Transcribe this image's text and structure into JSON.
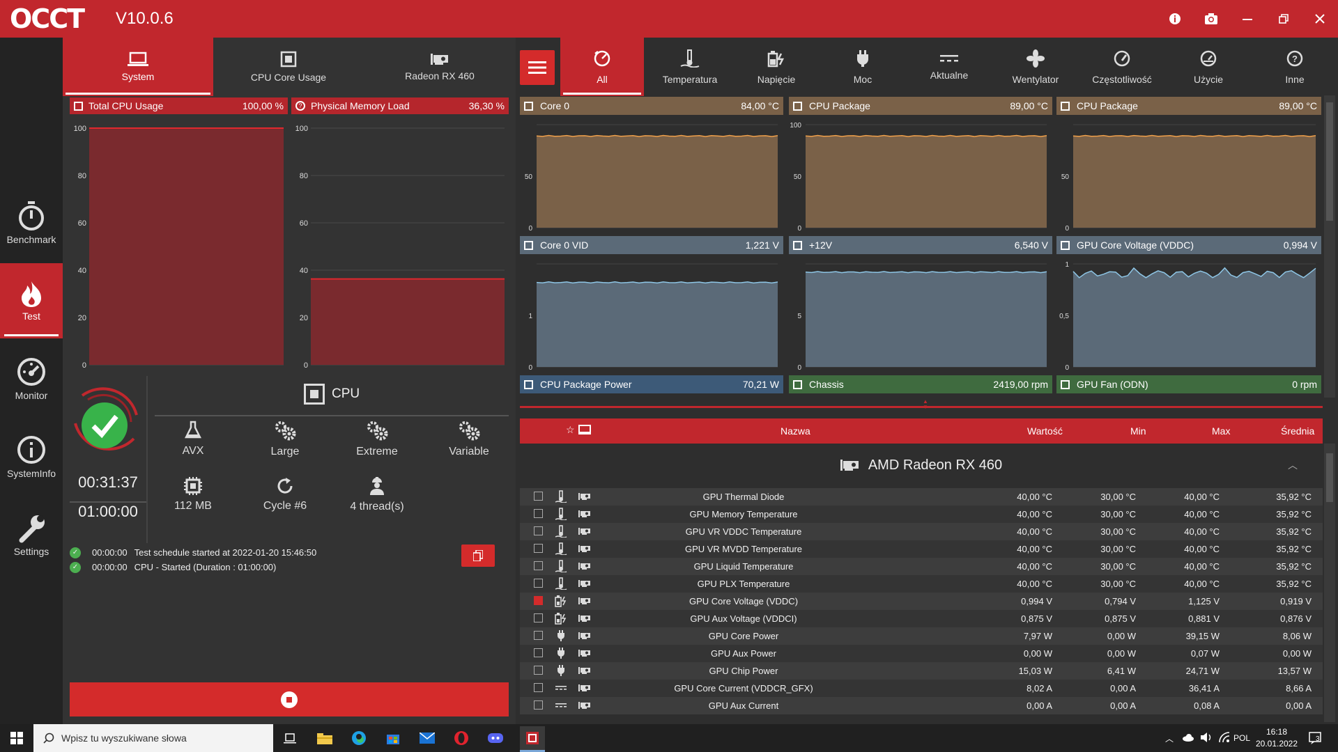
{
  "app": {
    "logo": "OCCT",
    "version": "V10.0.6"
  },
  "nav": [
    {
      "label": "Benchmark"
    },
    {
      "label": "Test"
    },
    {
      "label": "Monitor"
    },
    {
      "label": "SystemInfo"
    },
    {
      "label": "Settings"
    }
  ],
  "left_tabs": [
    "System",
    "CPU Core Usage",
    "Radeon RX 460"
  ],
  "left_charts": [
    {
      "title": "Total CPU Usage",
      "value": "100,00 %",
      "ticks": [
        "100",
        "80",
        "60",
        "40",
        "20",
        "0"
      ]
    },
    {
      "title": "Physical Memory Load",
      "value": "36,30 %",
      "ticks": [
        "100",
        "80",
        "60",
        "40",
        "20",
        "0"
      ]
    }
  ],
  "test": {
    "elapsed": "00:31:37",
    "duration": "01:00:00",
    "name": "CPU",
    "options": [
      {
        "label": "AVX",
        "icon": "flask-icon"
      },
      {
        "label": "Large",
        "icon": "gears-icon"
      },
      {
        "label": "Extreme",
        "icon": "gears-icon"
      },
      {
        "label": "Variable",
        "icon": "gears-icon"
      },
      {
        "label": "112 MB",
        "icon": "chip-icon"
      },
      {
        "label": "Cycle #6",
        "icon": "refresh-icon"
      },
      {
        "label": "4 thread(s)",
        "icon": "worker-icon"
      }
    ],
    "log": [
      {
        "time": "00:00:00",
        "text": "Test schedule started at 2022-01-20 15:46:50"
      },
      {
        "time": "00:00:00",
        "text": "CPU - Started (Duration : 01:00:00)"
      }
    ]
  },
  "right_tabs": [
    "All",
    "Temperatura",
    "Napięcie",
    "Moc",
    "Aktualne",
    "Wentylator",
    "Częstotliwość",
    "Użycie",
    "Inne"
  ],
  "monitor_charts": [
    {
      "title": "Core 0",
      "value": "84,00 °C",
      "ticks": [
        "",
        "50",
        "0"
      ],
      "color": "#7a6148"
    },
    {
      "title": "CPU Package",
      "value": "89,00 °C",
      "ticks": [
        "100",
        "50",
        "0"
      ],
      "color": "#7a6148"
    },
    {
      "title": "CPU Package",
      "value": "89,00 °C",
      "ticks": [
        "",
        "50",
        "0"
      ],
      "color": "#7a6148"
    },
    {
      "title": "Core 0 VID",
      "value": "1,221 V",
      "ticks": [
        "",
        "1",
        "0"
      ],
      "color": "#5b6a78"
    },
    {
      "title": "+12V",
      "value": "6,540 V",
      "ticks": [
        "",
        "5",
        "0"
      ],
      "color": "#5b6a78"
    },
    {
      "title": "GPU Core Voltage (VDDC)",
      "value": "0,994 V",
      "ticks": [
        "1",
        "0,5",
        "0"
      ],
      "color": "#5b6a78"
    },
    {
      "title": "CPU Package Power",
      "value": "70,21 W",
      "color": "#3d5a78"
    },
    {
      "title": "Chassis",
      "value": "2419,00 rpm",
      "color": "#3f6b3f"
    },
    {
      "title": "GPU Fan (ODN)",
      "value": "0 rpm",
      "color": "#3f6b3f"
    }
  ],
  "table": {
    "headers": {
      "name": "Nazwa",
      "value": "Wartość",
      "min": "Min",
      "max": "Max",
      "avg": "Średnia"
    },
    "group": "AMD Radeon RX 460",
    "rows": [
      {
        "name": "GPU Thermal Diode",
        "value": "40,00 °C",
        "min": "30,00 °C",
        "max": "40,00 °C",
        "avg": "35,92 °C",
        "type": "temp",
        "checked": false
      },
      {
        "name": "GPU Memory Temperature",
        "value": "40,00 °C",
        "min": "30,00 °C",
        "max": "40,00 °C",
        "avg": "35,92 °C",
        "type": "temp",
        "checked": false
      },
      {
        "name": "GPU VR VDDC Temperature",
        "value": "40,00 °C",
        "min": "30,00 °C",
        "max": "40,00 °C",
        "avg": "35,92 °C",
        "type": "temp",
        "checked": false
      },
      {
        "name": "GPU VR MVDD Temperature",
        "value": "40,00 °C",
        "min": "30,00 °C",
        "max": "40,00 °C",
        "avg": "35,92 °C",
        "type": "temp",
        "checked": false
      },
      {
        "name": "GPU Liquid Temperature",
        "value": "40,00 °C",
        "min": "30,00 °C",
        "max": "40,00 °C",
        "avg": "35,92 °C",
        "type": "temp",
        "checked": false
      },
      {
        "name": "GPU PLX Temperature",
        "value": "40,00 °C",
        "min": "30,00 °C",
        "max": "40,00 °C",
        "avg": "35,92 °C",
        "type": "temp",
        "checked": false
      },
      {
        "name": "GPU Core Voltage (VDDC)",
        "value": "0,994 V",
        "min": "0,794 V",
        "max": "1,125 V",
        "avg": "0,919 V",
        "type": "volt",
        "checked": true
      },
      {
        "name": "GPU Aux Voltage (VDDCI)",
        "value": "0,875 V",
        "min": "0,875 V",
        "max": "0,881 V",
        "avg": "0,876 V",
        "type": "volt",
        "checked": false
      },
      {
        "name": "GPU Core Power",
        "value": "7,97 W",
        "min": "0,00 W",
        "max": "39,15 W",
        "avg": "8,06 W",
        "type": "power",
        "checked": false
      },
      {
        "name": "GPU Aux Power",
        "value": "0,00 W",
        "min": "0,00 W",
        "max": "0,07 W",
        "avg": "0,00 W",
        "type": "power",
        "checked": false
      },
      {
        "name": "GPU Chip Power",
        "value": "15,03 W",
        "min": "6,41 W",
        "max": "24,71 W",
        "avg": "13,57 W",
        "type": "power",
        "checked": false
      },
      {
        "name": "GPU Core Current (VDDCR_GFX)",
        "value": "8,02 A",
        "min": "0,00 A",
        "max": "36,41 A",
        "avg": "8,66 A",
        "type": "current",
        "checked": false
      },
      {
        "name": "GPU Aux Current",
        "value": "0,00 A",
        "min": "0,00 A",
        "max": "0,08 A",
        "avg": "0,00 A",
        "type": "current",
        "checked": false
      }
    ]
  },
  "taskbar": {
    "search_placeholder": "Wpisz tu wyszukiwane słowa",
    "lang": "POL",
    "time": "16:18",
    "date": "20.01.2022",
    "notifications": "3"
  }
}
